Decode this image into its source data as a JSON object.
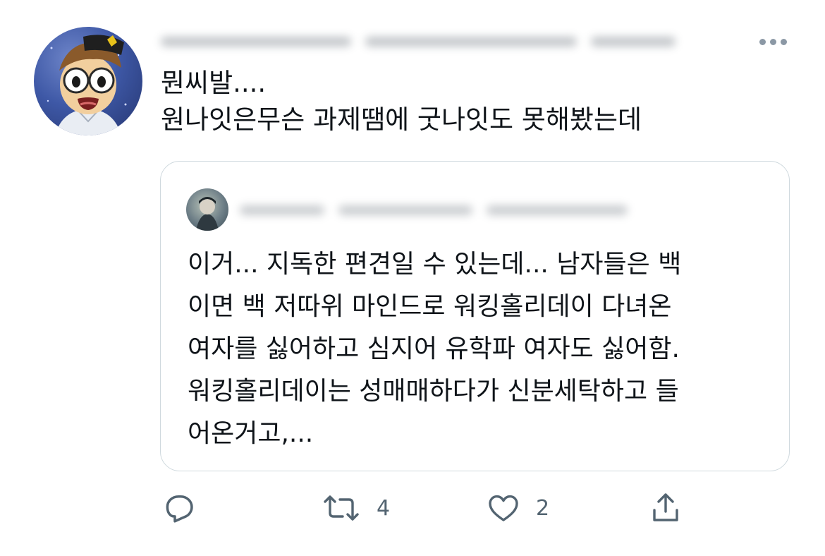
{
  "tweet": {
    "text": "뭔씨발....\n원나잇은무슨 과제땜에 굿나잇도 못해봤는데"
  },
  "quoted_tweet": {
    "text": "이거... 지독한 편견일 수 있는데... 남자들은 백\n이면 백 저따위 마인드로 워킹홀리데이 다녀온\n여자를 싫어하고 심지어 유학파 여자도 싫어함.\n워킹홀리데이는 성매매하다가 신분세탁하고 들\n어온거고,..."
  },
  "actions": {
    "reply_icon": "reply-icon",
    "retweet_icon": "retweet-icon",
    "retweet_count": "4",
    "like_icon": "heart-icon",
    "like_count": "2",
    "share_icon": "share-icon"
  },
  "colors": {
    "text": "#0f1419",
    "secondary": "#536471",
    "border": "#cfd9de"
  }
}
